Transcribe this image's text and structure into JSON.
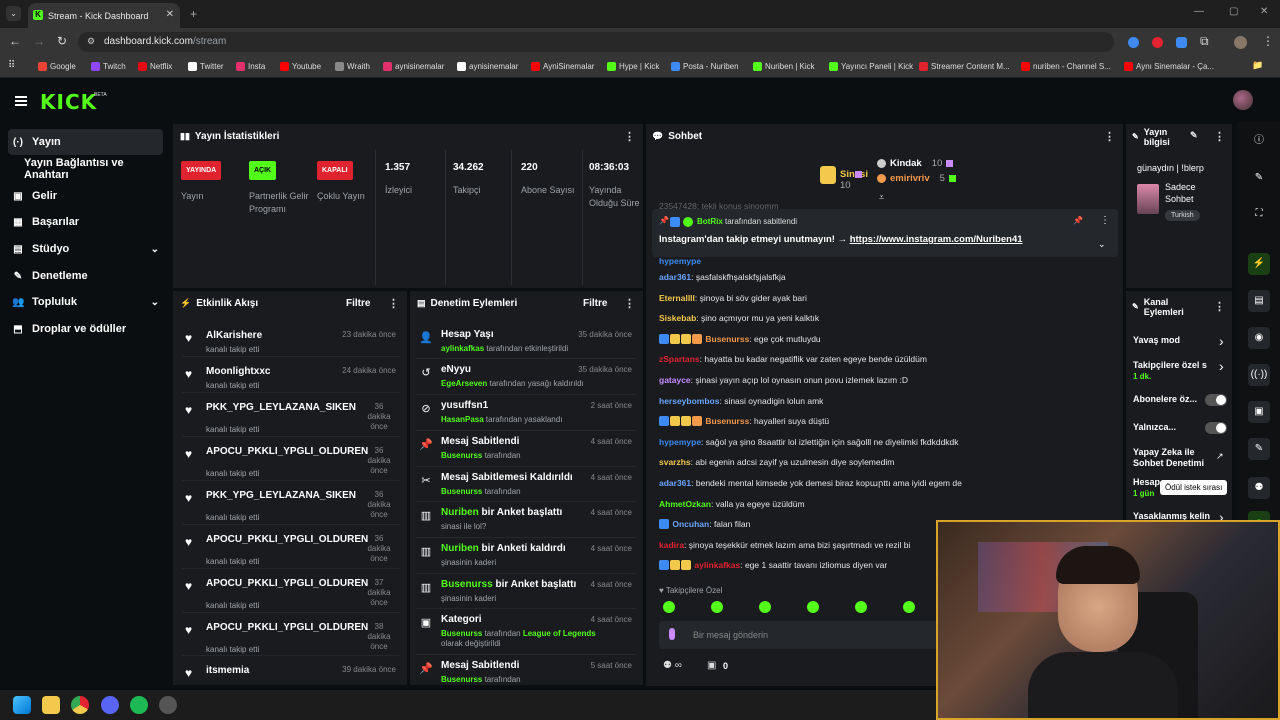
{
  "browser": {
    "tab_title": "Stream - Kick Dashboard",
    "tab_favicon": "K",
    "url_host": "dashboard.kick.com",
    "url_path": "/stream",
    "bookmarks": [
      "Google",
      "Twitch",
      "Netflix",
      "Twitter",
      "Insta",
      "Youtube",
      "Wraith",
      "aynisinemalar",
      "aynisinemalar",
      "AyniSinemalar",
      "Hype | Kick",
      "Posta - Nuriben",
      "Nuriben | Kick",
      "Yayıncı Paneli | Kick",
      "Streamer Content M...",
      "nuriben - Channel S...",
      "Aynı Sinemalar - Ça..."
    ]
  },
  "header": {
    "logo": "KICK",
    "beta": "BETA"
  },
  "sidebar": {
    "items": [
      {
        "label": "Yayın",
        "icon": "(·)"
      },
      {
        "label": "Yayın Bağlantısı ve Anahtarı",
        "icon": ""
      },
      {
        "label": "Gelir",
        "icon": "▣"
      },
      {
        "label": "Başarılar",
        "icon": "▦"
      },
      {
        "label": "Stüdyo",
        "icon": "▤"
      },
      {
        "label": "Denetleme",
        "icon": "✎"
      },
      {
        "label": "Topluluk",
        "icon": "👥"
      },
      {
        "label": "Droplar ve ödüller",
        "icon": "⬒"
      }
    ]
  },
  "stats": {
    "title": "Yayın İstatistikleri",
    "badges": [
      {
        "badge": "YAYINDA",
        "label": "Yayın",
        "color": "#e0232e"
      },
      {
        "badge": "AÇIK",
        "label": "Partnerlik Gelir Programı",
        "color": "#53fc18"
      },
      {
        "badge": "KAPALI",
        "label": "Çoklu Yayın",
        "color": "#e0232e"
      }
    ],
    "values": [
      {
        "value": "1.357",
        "label": "İzleyici"
      },
      {
        "value": "34.262",
        "label": "Takipçi"
      },
      {
        "value": "220",
        "label": "Abone Sayısı"
      },
      {
        "value": "08:36:03",
        "label": "Yayında Olduğu Süre"
      }
    ]
  },
  "activity": {
    "title": "Etkinlik Akışı",
    "filter": "Filtre",
    "items": [
      {
        "name": "AlKarishere",
        "sub": "kanalı takip etti",
        "time": "23 dakika önce"
      },
      {
        "name": "Moonlightxxc",
        "sub": "kanalı takip etti",
        "time": "24 dakika önce"
      },
      {
        "name": "PKK_YPG_LEYLAZANA_SIKEN",
        "sub": "kanalı takip etti",
        "time": "36 dakika önce"
      },
      {
        "name": "APOCU_PKKLI_YPGLI_OLDUREN",
        "sub": "kanalı takip etti",
        "time": "36 dakika önce"
      },
      {
        "name": "PKK_YPG_LEYLAZANA_SIKEN",
        "sub": "kanalı takip etti",
        "time": "36 dakika önce"
      },
      {
        "name": "APOCU_PKKLI_YPGLI_OLDUREN",
        "sub": "kanalı takip etti",
        "time": "36 dakika önce"
      },
      {
        "name": "APOCU_PKKLI_YPGLI_OLDUREN",
        "sub": "kanalı takip etti",
        "time": "37 dakika önce"
      },
      {
        "name": "APOCU_PKKLI_YPGLI_OLDUREN",
        "sub": "kanalı takip etti",
        "time": "38 dakika önce"
      },
      {
        "name": "itsmemia",
        "sub": "",
        "time": "39 dakika önce"
      }
    ]
  },
  "moderation": {
    "title": "Denetim Eylemleri",
    "filter": "Filtre",
    "items": [
      {
        "icon": "👤",
        "title": "Hesap Yaşı",
        "user": "aylinkafkas",
        "rest": " tarafından etkinleştirildi",
        "time": "35 dakika önce"
      },
      {
        "icon": "↺",
        "title": "eNyyu",
        "user": "EgeArseven",
        "rest": " tarafından yasağı kaldırıldı",
        "time": "35 dakika önce"
      },
      {
        "icon": "⊘",
        "title": "yusuffsn1",
        "user": "HasanPasa",
        "rest": " tarafından yasaklandı",
        "time": "2 saat önce"
      },
      {
        "icon": "📌",
        "title": "Mesaj Sabitlendi",
        "user": "Busenurss",
        "rest": " tarafından",
        "time": "4 saat önce"
      },
      {
        "icon": "✂",
        "title": "Mesaj Sabitlemesi Kaldırıldı",
        "user": "Busenurss",
        "rest": " tarafından",
        "time": "4 saat önce"
      },
      {
        "icon": "▥",
        "title_user": "Nuriben",
        "title": " bir Anket başlattı",
        "sub": "sinasi ile lol?",
        "time": "4 saat önce"
      },
      {
        "icon": "▥",
        "title_user": "Nuriben",
        "title": " bir Anketi kaldırdı",
        "sub": "şinasinin kaderi",
        "time": "4 saat önce"
      },
      {
        "icon": "▥",
        "title_user": "Busenurss",
        "title": " bir Anket başlattı",
        "sub": "şinasinin kaderi",
        "time": "4 saat önce"
      },
      {
        "icon": "▣",
        "title": "Kategori",
        "user": "Busenurss",
        "rest": " tarafından ",
        "extra_user": "League of Legends",
        "extra": " olarak değiştirildi",
        "time": "4 saat önce"
      },
      {
        "icon": "📌",
        "title": "Mesaj Sabitlendi",
        "user": "Busenurss",
        "rest": " tarafından",
        "time": "5 saat önce"
      }
    ]
  },
  "chat": {
    "title": "Sohbet",
    "leaders": [
      {
        "name": "Sinasi",
        "count": "10",
        "color": "#f2c94c"
      },
      {
        "name": "Kindak",
        "count": "10",
        "color": "#ffffff"
      },
      {
        "name": "emirivriv",
        "count": "5",
        "color": "#f2994a"
      }
    ],
    "cut_line": "23547428: tekli konus sinoomm",
    "pinned": {
      "by_user": "BotRix",
      "by_text": " tarafından sabitlendi",
      "message": "Instagram'dan takip etmeyi unutmayın! → ",
      "link": "https://www.instagram.com/Nuriben41"
    },
    "messages": [
      {
        "user": "hypemype",
        "color": "#3d8bf2",
        "text": "",
        "badges": 0
      },
      {
        "user": "adar361",
        "color": "#6aa6ff",
        "text": ": şasfalskfhşalskfşjalsfkja",
        "badges": 0
      },
      {
        "user": "Eternallll",
        "color": "#f2c94c",
        "text": ": şinoya bi söv gider ayak bari",
        "badges": 0
      },
      {
        "user": "Siskebab",
        "color": "#f2c94c",
        "text": ": şino açmıyor mu ya yeni kalktık",
        "badges": 0
      },
      {
        "user": "Busenurss",
        "color": "#f2994a",
        "text": ": ege çok mutluydu",
        "badges": 4
      },
      {
        "user": "zSpartans",
        "color": "#e0232e",
        "text": ": hayatta bu kadar negatiflik var zaten egeye bende üzüldüm",
        "badges": 0
      },
      {
        "user": "gatayce",
        "color": "#c98bff",
        "text": ": şinasi yayın açıp lol oynasın onun povu izlemek lazım :D",
        "badges": 0
      },
      {
        "user": "herseybombos",
        "color": "#6aa6ff",
        "text": ": sinasi oynadigin lolun amk",
        "badges": 0
      },
      {
        "user": "Busenurss",
        "color": "#f2994a",
        "text": ": hayalleri suya düştü",
        "badges": 4
      },
      {
        "user": "hypemype",
        "color": "#3d8bf2",
        "text": ": sağol ya şino 8saattir lol izlettiğin için sağolll ne diyelimki fkdkddkdk",
        "badges": 0
      },
      {
        "user": "svarzhs",
        "color": "#f2c94c",
        "text": ": abi egenin adcsi zayif ya uzulmesin diye soylemedim",
        "badges": 0
      },
      {
        "user": "adar361",
        "color": "#6aa6ff",
        "text": ": bendeki mental kimsede yok demesi biraz kopարttı ama iyidi egem de",
        "badges": 0
      },
      {
        "user": "AhmetOzkan",
        "color": "#53fc18",
        "text": ": valla ya egeye üzüldüm",
        "badges": 0
      },
      {
        "user": "Oncuhan",
        "color": "#6aa6ff",
        "text": ": falan filan",
        "badges": 1
      },
      {
        "user": "kadira",
        "color": "#e0232e",
        "text": ": şinoya teşekkür etmek lazım ama bizi şaşırtmadı ve rezil bi",
        "badges": 0
      },
      {
        "user": "aylinkafkas",
        "color": "#e0232e",
        "text": ": ege 1 saattir tavanı izliomus diyen var",
        "badges": 3
      }
    ],
    "followers_only": "Takipçilere Özel",
    "input_placeholder": "Bir mesaj gönderin",
    "viewer_count": "0"
  },
  "stream_info": {
    "title": "Yayın bilgisi",
    "stream_title": "günaydın | !blerp",
    "category": "Sadece Sohbet",
    "tag": "Turkish"
  },
  "channel_actions": {
    "title": "Kanal Eylemleri",
    "items": [
      {
        "label": "Yavaş mod",
        "sub": ""
      },
      {
        "label": "Takipçilere özel s",
        "sub": "1 dk."
      },
      {
        "label": "Abonelere öz...",
        "sub": ""
      },
      {
        "label": "Yalnızca...",
        "sub": ""
      },
      {
        "label": "Yapay Zeka ile Sohbet Denetimi",
        "sub": ""
      },
      {
        "label": "Hesap",
        "sub": "1 gün"
      },
      {
        "label": "Yasaklanmış kelin",
        "sub": ""
      }
    ],
    "tooltip": "Ödül istek sırası"
  },
  "colors": {
    "accent": "#53fc18",
    "panel": "#191b1f",
    "bg": "#0b0e10",
    "webcam_border": "#d8a52a"
  }
}
